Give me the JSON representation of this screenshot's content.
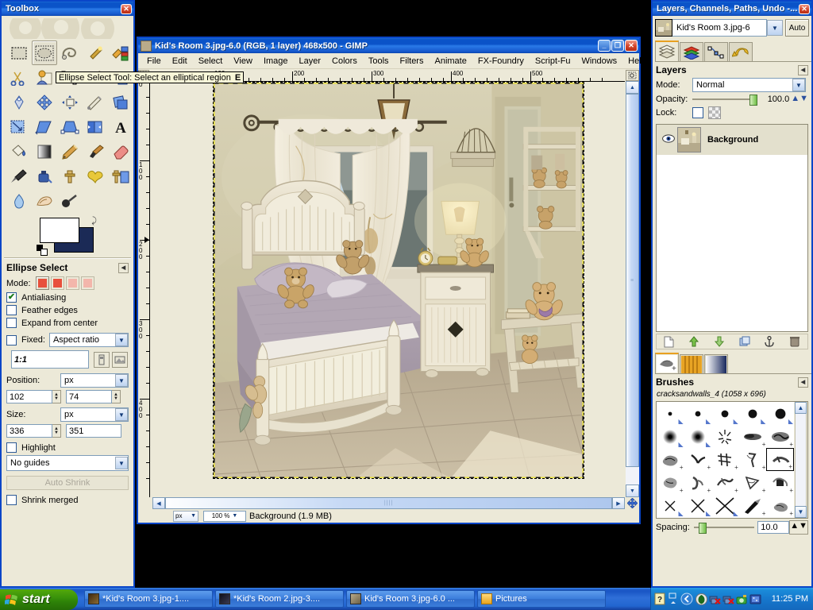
{
  "toolbox": {
    "title": "Toolbox",
    "close_label": "✕",
    "tools": [
      {
        "name": "rect-select-tool",
        "label": "Rectangle Select",
        "selected": false
      },
      {
        "name": "ellipse-select-tool",
        "label": "Ellipse Select",
        "selected": true
      },
      {
        "name": "free-select-tool",
        "label": "Free Select",
        "selected": false
      },
      {
        "name": "fuzzy-select-tool",
        "label": "Fuzzy Select",
        "selected": false
      },
      {
        "name": "select-by-color-tool",
        "label": "Select by Color",
        "selected": false
      },
      {
        "name": "scissors-select-tool",
        "label": "Scissors Select",
        "selected": false
      },
      {
        "name": "foreground-select-tool",
        "label": "Foreground Select",
        "selected": false
      },
      {
        "name": "paths-tool",
        "label": "Paths",
        "selected": false
      },
      {
        "name": "color-picker-tool",
        "label": "Color Picker",
        "selected": false
      },
      {
        "name": "zoom-tool",
        "label": "Zoom",
        "selected": false
      },
      {
        "name": "measure-tool",
        "label": "Measure",
        "selected": false
      },
      {
        "name": "move-tool",
        "label": "Move",
        "selected": false
      },
      {
        "name": "alignment-tool",
        "label": "Alignment",
        "selected": false
      },
      {
        "name": "crop-tool",
        "label": "Crop",
        "selected": false
      },
      {
        "name": "rotate-tool",
        "label": "Rotate",
        "selected": false
      },
      {
        "name": "scale-tool",
        "label": "Scale",
        "selected": false
      },
      {
        "name": "shear-tool",
        "label": "Shear",
        "selected": false
      },
      {
        "name": "perspective-tool",
        "label": "Perspective",
        "selected": false
      },
      {
        "name": "flip-tool",
        "label": "Flip",
        "selected": false
      },
      {
        "name": "text-tool",
        "label": "Text",
        "selected": false
      },
      {
        "name": "bucket-fill-tool",
        "label": "Bucket Fill",
        "selected": false
      },
      {
        "name": "blend-tool",
        "label": "Blend",
        "selected": false
      },
      {
        "name": "pencil-tool",
        "label": "Pencil",
        "selected": false
      },
      {
        "name": "paintbrush-tool",
        "label": "Paintbrush",
        "selected": false
      },
      {
        "name": "eraser-tool",
        "label": "Eraser",
        "selected": false
      },
      {
        "name": "airbrush-tool",
        "label": "Airbrush",
        "selected": false
      },
      {
        "name": "ink-tool",
        "label": "Ink",
        "selected": false
      },
      {
        "name": "clone-tool",
        "label": "Clone",
        "selected": false
      },
      {
        "name": "heal-tool",
        "label": "Heal",
        "selected": false
      },
      {
        "name": "perspective-clone-tool",
        "label": "Perspective Clone",
        "selected": false
      },
      {
        "name": "blur-sharpen-tool",
        "label": "Blur / Sharpen",
        "selected": false
      },
      {
        "name": "smudge-tool",
        "label": "Smudge",
        "selected": false
      },
      {
        "name": "dodge-burn-tool",
        "label": "Dodge / Burn",
        "selected": false
      }
    ],
    "colors": {
      "foreground": "#ffffff",
      "background": "#1b2a56"
    },
    "options": {
      "title": "Ellipse Select",
      "mode_label": "Mode:",
      "antialiasing_label": "Antialiasing",
      "antialiasing_checked": true,
      "feather_label": "Feather edges",
      "feather_checked": false,
      "expand_label": "Expand from center",
      "expand_checked": false,
      "fixed_label": "Fixed:",
      "fixed_checked": false,
      "fixed_value": "Aspect ratio",
      "ratio_value": "1:1",
      "position_label": "Position:",
      "position_unit": "px",
      "position_x": "102",
      "position_y": "74",
      "size_label": "Size:",
      "size_unit": "px",
      "size_w": "336",
      "size_h": "351",
      "highlight_label": "Highlight",
      "highlight_checked": false,
      "guides_value": "No guides",
      "auto_shrink_label": "Auto Shrink",
      "shrink_merged_label": "Shrink merged",
      "shrink_merged_checked": false
    }
  },
  "tooltip": {
    "text": "Ellipse Select Tool: Select an elliptical region",
    "shortcut": "E"
  },
  "image_window": {
    "title": "Kid's Room 3.jpg-6.0 (RGB, 1 layer) 468x500 - GIMP",
    "minimize_label": "_",
    "maximize_label": "❐",
    "close_label": "✕",
    "menu": [
      "File",
      "Edit",
      "Select",
      "View",
      "Image",
      "Layer",
      "Colors",
      "Tools",
      "Filters",
      "Animate",
      "FX-Foundry",
      "Script-Fu",
      "Windows",
      "Help"
    ],
    "ruler_h_labels": [
      "100",
      "200",
      "300",
      "400",
      "500"
    ],
    "ruler_v_labels": [
      "0",
      "100",
      "200",
      "300",
      "400"
    ],
    "status": {
      "unit": "px",
      "zoom": "100 %",
      "text": "Background (1.9 MB)"
    }
  },
  "dock": {
    "title": "Layers, Channels, Paths, Undo -...",
    "close_label": "✕",
    "image_name": "Kid's Room 3.jpg-6",
    "auto_label": "Auto",
    "tabs": [
      {
        "name": "tab-layers",
        "label": "Layers",
        "active": true
      },
      {
        "name": "tab-channels",
        "label": "Channels",
        "active": false
      },
      {
        "name": "tab-paths",
        "label": "Paths",
        "active": false
      },
      {
        "name": "tab-undo",
        "label": "Undo History",
        "active": false
      }
    ],
    "layers_panel": {
      "title": "Layers",
      "mode_label": "Mode:",
      "mode_value": "Normal",
      "opacity_label": "Opacity:",
      "opacity_value": "100.0",
      "lock_label": "Lock:",
      "layers": [
        {
          "name": "Background",
          "visible": true,
          "selected": true
        }
      ],
      "buttons": [
        "new-layer",
        "raise-layer",
        "lower-layer",
        "duplicate-layer",
        "anchor-layer",
        "delete-layer"
      ]
    },
    "brush_tabs": [
      {
        "name": "tab-brushes",
        "label": "Brushes",
        "active": true
      },
      {
        "name": "tab-patterns",
        "label": "Patterns",
        "active": false
      },
      {
        "name": "tab-gradients",
        "label": "Gradients",
        "active": false
      }
    ],
    "brushes_panel": {
      "title": "Brushes",
      "selected_brush": "cracksandwalls_4 (1058 x 696)",
      "spacing_label": "Spacing:",
      "spacing_value": "10.0",
      "rows": 5,
      "cols": 5,
      "selected_index": 14
    }
  },
  "taskbar": {
    "start_label": "start",
    "tasks": [
      {
        "name": "taskbar-item-1",
        "label": "*Kid's Room 3.jpg-1...."
      },
      {
        "name": "taskbar-item-2",
        "label": "*Kid's Room 2.jpg-3...."
      },
      {
        "name": "taskbar-item-3",
        "label": "Kid's Room 3.jpg-6.0 ..."
      },
      {
        "name": "taskbar-item-4",
        "label": "Pictures"
      }
    ],
    "clock": "11:25 PM"
  }
}
